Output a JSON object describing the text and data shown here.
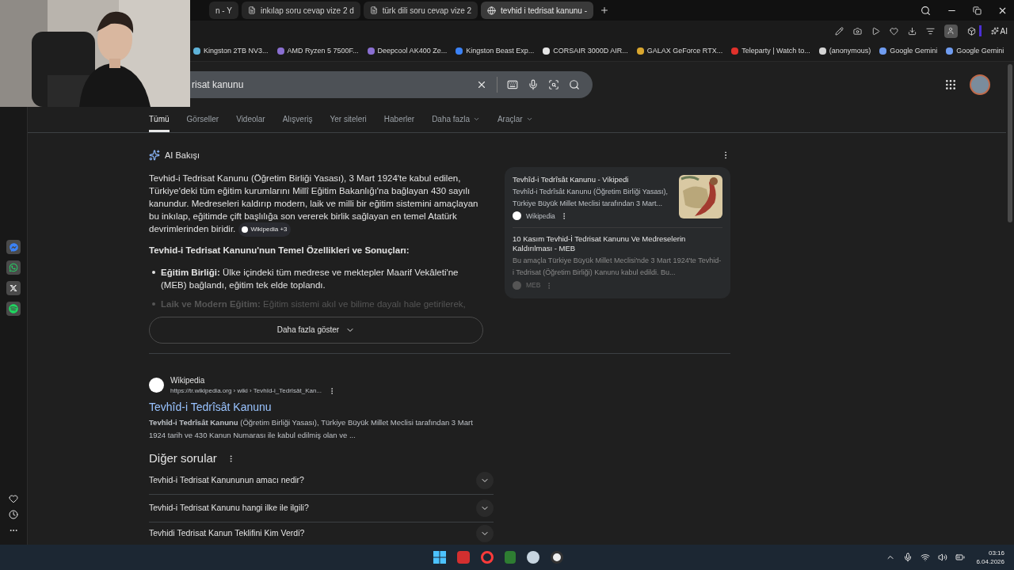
{
  "browser": {
    "tabs": [
      {
        "title": "n - Y",
        "selected": false
      },
      {
        "title": "inkılap soru cevap vize 2 d",
        "selected": false
      },
      {
        "title": "türk dili soru cevap vize 2",
        "selected": false
      },
      {
        "title": "tevhid i tedrisat kanunu -",
        "selected": true
      }
    ],
    "ai_button": "AI",
    "bookmarks": [
      {
        "label": "Kingston 2TB NV3...",
        "color": "#5fb3d9"
      },
      {
        "label": "AMD Ryzen 5 7500F...",
        "color": "#8a6fd1"
      },
      {
        "label": "Deepcool AK400 Ze...",
        "color": "#8a6fd1"
      },
      {
        "label": "Kingston Beast Exp...",
        "color": "#3b82f6"
      },
      {
        "label": "CORSAIR 3000D AIR...",
        "color": "#e5e5e5"
      },
      {
        "label": "GALAX GeForce RTX...",
        "color": "#d9a62e"
      },
      {
        "label": "Teleparty | Watch to...",
        "color": "#e0312b"
      },
      {
        "label": "(anonymous)",
        "color": "#d4d4d4"
      },
      {
        "label": "Google Gemini",
        "color": "#6f9cf0"
      },
      {
        "label": "Google Gemini",
        "color": "#6f9cf0"
      }
    ]
  },
  "search": {
    "value": "risat kanunu"
  },
  "search_tabs": [
    {
      "label": "Tümü",
      "selected": true,
      "kind": "plain"
    },
    {
      "label": "Görseller",
      "selected": false,
      "kind": "plain"
    },
    {
      "label": "Videolar",
      "selected": false,
      "kind": "plain"
    },
    {
      "label": "Alışveriş",
      "selected": false,
      "kind": "plain"
    },
    {
      "label": "Yer siteleri",
      "selected": false,
      "kind": "plain"
    },
    {
      "label": "Haberler",
      "selected": false,
      "kind": "plain"
    },
    {
      "label": "Daha fazla",
      "selected": false,
      "kind": "menu"
    },
    {
      "label": "Araçlar",
      "selected": false,
      "kind": "menu"
    }
  ],
  "ai_overview": {
    "title": "AI Bakışı",
    "paragraph": "Tevhid-i Tedrisat Kanunu (Öğretim Birliği Yasası), 3 Mart 1924'te kabul edilen, Türkiye'deki tüm eğitim kurumlarını Millî Eğitim Bakanlığı'na bağlayan 430 sayılı kanundur. Medreseleri kaldırıp modern, laik ve milli bir eğitim sistemini amaçlayan bu inkılap, eğitimde çift başlılığa son vererek birlik sağlayan en temel Atatürk devrimlerinden biridir.",
    "chip": "Wikipedia +3",
    "heading": "Tevhid-i Tedrisat Kanunu'nun Temel Özellikleri ve Sonuçları:",
    "bullets": [
      {
        "term": "Eğitim Birliği:",
        "text": "Ülke içindeki tüm medrese ve mektepler Maarif Vekâleti'ne (MEB) bağlandı, eğitim tek elde toplandı.",
        "faded": false
      },
      {
        "term": "Laik ve Modern Eğitim:",
        "text": "Eğitim sistemi akıl ve bilime dayalı hale getirilerek,",
        "faded": true
      }
    ],
    "more_button": "Daha fazla göster",
    "sources": [
      {
        "title": "Tevhîd-i Tedrîsât Kanunu - Vikipedi",
        "snippet": "Tevhîd-i Tedrîsât Kanunu (Öğretim Birliği Yasası), Türkiye Büyük Millet Meclisi tarafından 3 Mart...",
        "site": "Wikipedia",
        "thumbnail": true,
        "faded": false
      },
      {
        "title": "10 Kasım Tevhid-İ Tedrisat Kanunu Ve Medreselerin Kaldırılması - MEB",
        "snippet": "Bu amaçla Türkiye Büyük Millet Meclisi'nde 3 Mart 1924'te Tevhid-i Tedrisat (Öğretim Birliği) Kanunu kabul edildi. Bu...",
        "site": "MEB",
        "thumbnail": false,
        "faded": true
      }
    ]
  },
  "result": {
    "site": "Wikipedia",
    "url": "https://tr.wikipedia.org › wiki › Tevhîd-i_Tedrîsât_Kan...",
    "title": "Tevhîd-i Tedrîsât Kanunu",
    "snippet": "**Tevhîd-i Tedrîsât Kanunu** (Öğretim Birliği Yasası), Türkiye Büyük Millet Meclisi tarafından 3 Mart 1924 tarih ve 430 Kanun Numarası ile kabul edilmiş olan ve ..."
  },
  "other_questions": {
    "title": "Diğer sorular",
    "items": [
      {
        "question": "Tevhid-i Tedrisat Kanununun amacı nedir?",
        "expanded": false
      },
      {
        "question": "Tevhid-i Tedrisat Kanunu hangi ilke ile ilgili?",
        "expanded": false
      },
      {
        "question": "Tevhidi Tedrisat Kanun Teklifini Kim Verdi?",
        "expanded": false
      }
    ]
  },
  "taskbar": {
    "time": "03:16",
    "date": "6.04.2026"
  }
}
